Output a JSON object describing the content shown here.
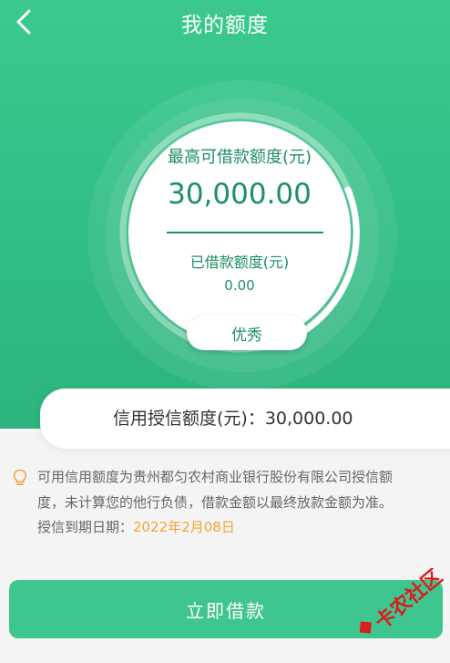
{
  "header": {
    "title": "我的额度",
    "back_icon": "chevron-left-icon"
  },
  "credit_circle": {
    "max_label": "最高可借款额度(元)",
    "max_amount": "30,000.00",
    "used_label": "已借款额度(元)",
    "used_amount": "0.00",
    "rating": "优秀"
  },
  "credit_limit": {
    "text": "信用授信额度(元)：30,000.00"
  },
  "notice": {
    "icon": "lightbulb-icon",
    "line1": "可用信用额度为贵州都匀农村商业银行股份有限公司授信额",
    "line2": "度，未计算您的他行负债，借款金额以最终放款金额为准。",
    "line3_label": "授信到期日期：",
    "line3_date": "2022年2月08日"
  },
  "action": {
    "borrow_label": "立即借款"
  },
  "watermark": {
    "text": "卡农社区"
  },
  "colors": {
    "brand_green": "#31bd84",
    "text_green": "#1d8f62",
    "date_orange": "#f2a534",
    "button_green": "#3fc58e"
  }
}
